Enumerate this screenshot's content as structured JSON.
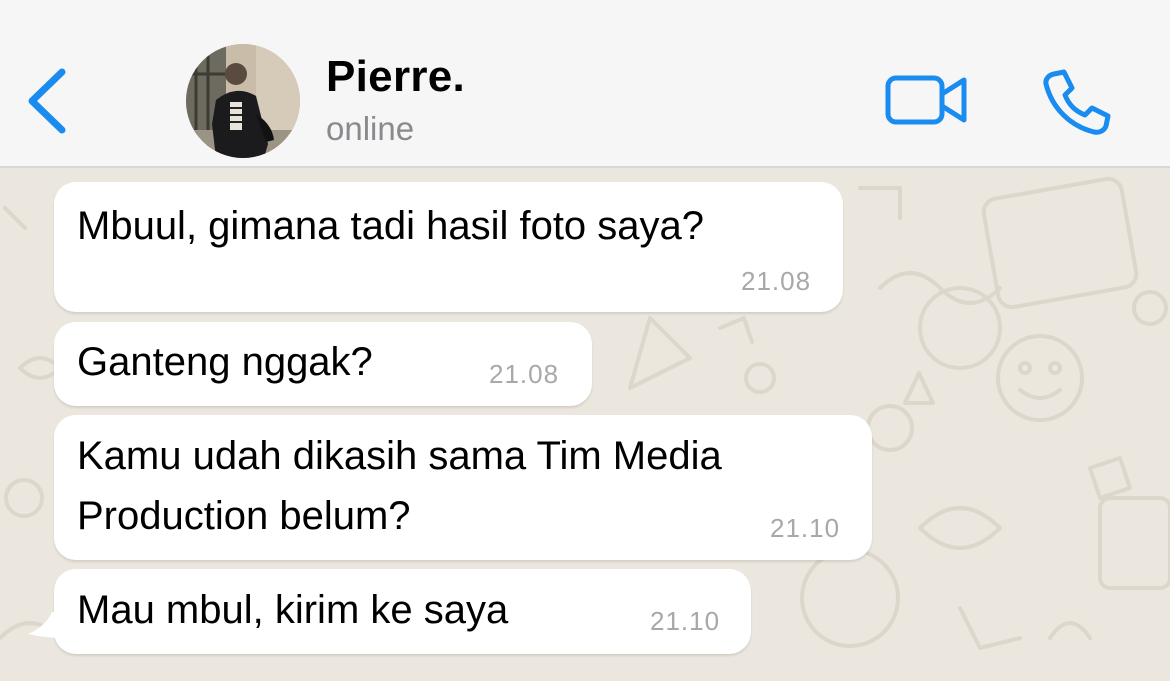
{
  "header": {
    "back_icon": "chevron-left-icon",
    "contact_name": "Pierre.",
    "status": "online",
    "video_icon": "video-camera-icon",
    "call_icon": "phone-icon",
    "accent_color": "#1a8cf0"
  },
  "messages": [
    {
      "lines": [
        "Mbuul, gimana tadi hasil foto saya?"
      ],
      "time": "21.08"
    },
    {
      "lines": [
        "Ganteng nggak?"
      ],
      "time": "21.08"
    },
    {
      "lines": [
        "Kamu udah dikasih sama Tim Media",
        "Production belum?"
      ],
      "time": "21.10"
    },
    {
      "lines": [
        "Mau mbul, kirim ke saya"
      ],
      "time": "21.10"
    }
  ],
  "colors": {
    "header_bg": "#f6f6f6",
    "chat_bg": "#ebe6de",
    "bubble_bg": "#ffffff",
    "timestamp": "#a8a8a8",
    "status_text": "#8a8a8e"
  }
}
